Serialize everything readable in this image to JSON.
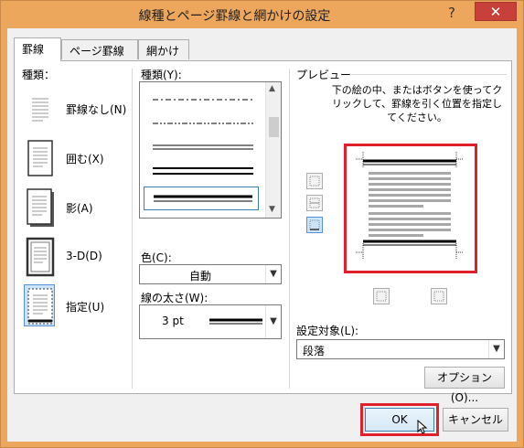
{
  "window": {
    "title": "線種とページ罫線と網かけの設定",
    "help_glyph": "?",
    "close_glyph": "✕"
  },
  "tabs": [
    {
      "label": "罫線"
    },
    {
      "label": "ページ罫線"
    },
    {
      "label": "網かけ"
    }
  ],
  "settings": {
    "label": "種類：",
    "items": [
      {
        "label": "罫線なし(N)",
        "icon": "border-none-icon"
      },
      {
        "label": "囲む(X)",
        "icon": "border-box-icon"
      },
      {
        "label": "影(A)",
        "icon": "border-shadow-icon"
      },
      {
        "label": "3-D(D)",
        "icon": "border-3d-icon"
      },
      {
        "label": "指定(U)",
        "icon": "border-custom-icon",
        "selected": true
      }
    ]
  },
  "style": {
    "label": "種類(Y):",
    "lines": [
      "dash-dot",
      "dash-dot-dot",
      "double-thin",
      "double-thick",
      "thick-thin"
    ],
    "selected_index": 4
  },
  "color": {
    "label": "色(C):",
    "value": "自動"
  },
  "width": {
    "label": "線の太さ(W):",
    "value": "3 pt"
  },
  "preview": {
    "label": "プレビュー",
    "instruction": "下の絵の中、またはボタンを使ってクリックして、罫線を引く位置を指定してください。"
  },
  "apply_to": {
    "label": "設定対象(L):",
    "value": "段落"
  },
  "buttons": {
    "options": "オプション(O)...",
    "ok": "OK",
    "cancel": "キャンセル"
  }
}
